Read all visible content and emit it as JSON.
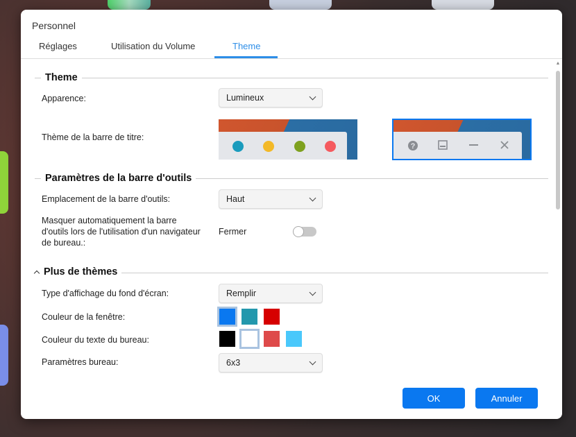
{
  "dialog": {
    "title": "Personnel"
  },
  "tabs": [
    {
      "label": "Réglages"
    },
    {
      "label": "Utilisation du Volume"
    },
    {
      "label": "Theme",
      "active": true
    }
  ],
  "theme_section": {
    "heading": "Theme",
    "appearance": {
      "label": "Apparence:",
      "value": "Lumineux"
    },
    "titlebar_theme": {
      "label": "Thème de la barre de titre:",
      "options": [
        "colored-dots",
        "gray-icons"
      ],
      "selected": "gray-icons",
      "dot_colors": [
        "#1a9bbd",
        "#f3b928",
        "#7ea11f",
        "#f55a5f"
      ],
      "icons": [
        "help-icon",
        "minimize-to-panel-icon",
        "minimize-icon",
        "close-icon"
      ]
    }
  },
  "toolbar_section": {
    "heading": "Paramètres de la barre d'outils",
    "location": {
      "label": "Emplacement de la barre d'outils:",
      "value": "Haut"
    },
    "autohide": {
      "label": "Masquer automatiquement la barre d'outils lors de l'utilisation d'un navigateur de bureau.:",
      "state_label": "Fermer",
      "enabled": false
    }
  },
  "more_section": {
    "heading": "Plus de thèmes",
    "wallpaper": {
      "label": "Type d'affichage du fond d'écran:",
      "value": "Remplir"
    },
    "window_color": {
      "label": "Couleur de la fenêtre:",
      "colors": [
        "#0a78f0",
        "#2398ad",
        "#d60000"
      ],
      "selected": 0
    },
    "text_color": {
      "label": "Couleur du texte du bureau:",
      "colors": [
        "#000000",
        "#ffffff",
        "#de4a4a",
        "#4ac8fb"
      ],
      "selected": 1
    },
    "desktop": {
      "label": "Paramètres bureau:",
      "value": "6x3"
    }
  },
  "footer": {
    "ok": "OK",
    "cancel": "Annuler"
  }
}
